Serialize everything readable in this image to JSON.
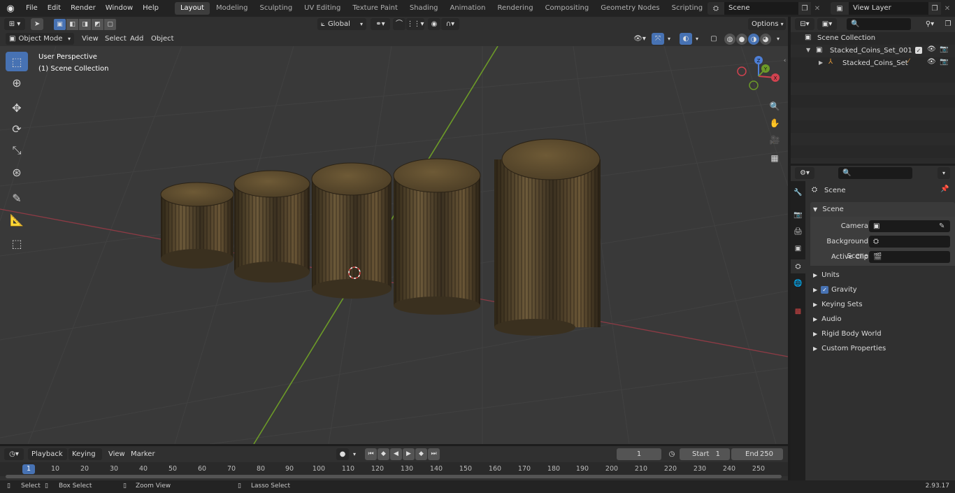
{
  "menubar": {
    "items": [
      "File",
      "Edit",
      "Render",
      "Window",
      "Help"
    ],
    "workspaces": [
      "Layout",
      "Modeling",
      "Sculpting",
      "UV Editing",
      "Texture Paint",
      "Shading",
      "Animation",
      "Rendering",
      "Compositing",
      "Geometry Nodes",
      "Scripting"
    ],
    "active_workspace": "Layout",
    "scene": "Scene",
    "view_layer": "View Layer"
  },
  "viewport_header": {
    "mode": "Object Mode",
    "menus": [
      "View",
      "Select",
      "Add",
      "Object"
    ],
    "transform_orientation": "Global",
    "options": "Options"
  },
  "viewport": {
    "perspective": "User Perspective",
    "collection": "(1) Scene Collection",
    "gizmo_axes": [
      "X",
      "Y",
      "Z"
    ]
  },
  "outliner": {
    "root": "Scene Collection",
    "items": [
      {
        "label": "Stacked_Coins_Set_001"
      },
      {
        "label": "Stacked_Coins_Set"
      }
    ]
  },
  "properties": {
    "context": "Scene",
    "panel": "Scene",
    "fields": [
      {
        "label": "Camera"
      },
      {
        "label": "Background Scene"
      },
      {
        "label": "Active Clip"
      }
    ],
    "sections": [
      "Units",
      "Gravity",
      "Keying Sets",
      "Audio",
      "Rigid Body World",
      "Custom Properties"
    ],
    "gravity_checked": true
  },
  "timeline": {
    "menus": [
      "Playback",
      "Keying",
      "View",
      "Marker"
    ],
    "current_frame": "1",
    "start_label": "Start",
    "start": "1",
    "end_label": "End",
    "end": "250",
    "ticks": [
      "1",
      "10",
      "20",
      "30",
      "40",
      "50",
      "60",
      "70",
      "80",
      "90",
      "100",
      "110",
      "120",
      "130",
      "140",
      "150",
      "160",
      "170",
      "180",
      "190",
      "200",
      "210",
      "220",
      "230",
      "240",
      "250"
    ]
  },
  "statusbar": {
    "select": "Select",
    "box_select": "Box Select",
    "zoom_view": "Zoom View",
    "lasso_select": "Lasso Select",
    "version": "2.93.17"
  },
  "colors": {
    "accent": "#4772b3",
    "x_axis": "#b8424f",
    "y_axis": "#6c9a28",
    "coin": "#6b5738"
  }
}
